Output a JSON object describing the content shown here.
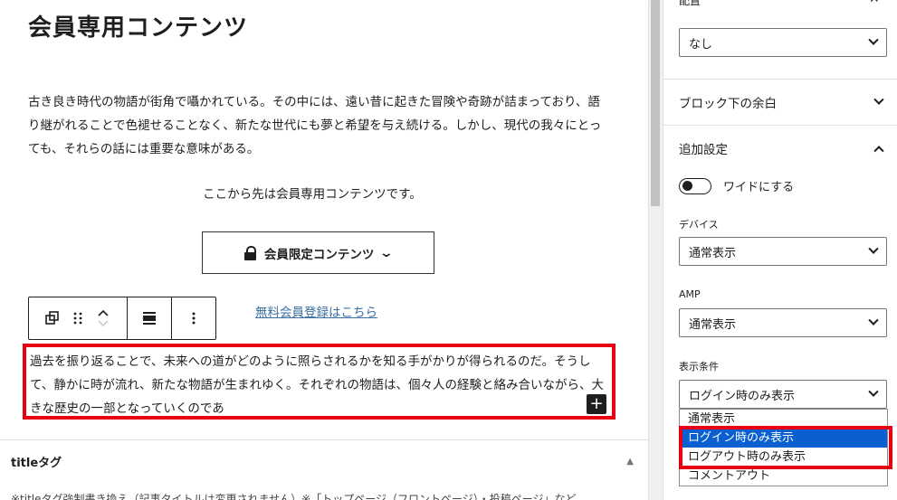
{
  "editor": {
    "title": "会員専用コンテンツ",
    "paragraph": "古き良き時代の物語が街角で囁かれている。その中には、遠い昔に起きた冒険や奇跡が詰まっており、語り継がれることで色褪せることなく、新たな世代にも夢と希望を与え続ける。しかし、現代の我々にとっても、それらの話には重要な意味がある。",
    "center_text": "ここから先は会員専用コンテンツです。",
    "member_button_label": "会員限定コンテンツ",
    "register_link": "無料会員登録はこちら",
    "selected_paragraph": "過去を振り返ることで、未来への道がどのように照らされるかを知る手がかりが得られるのだ。そうして、静かに時が流れ、新たな物語が生まれゆく。それぞれの物語は、個々人の経験と絡み合いながら、大きな歴史の一部となっていくのであ",
    "title_tag_label": "titleタグ",
    "cut_line": "※titleタグ強制書き換え（記事タイトルは変更されません）※「トップページ（フロントページ）・投稿ページ」など"
  },
  "sidebar": {
    "top_label": "配置",
    "top_select": "なし",
    "block_margin_label": "ブロック下の余白",
    "extra_settings_label": "追加設定",
    "wide_toggle_label": "ワイドにする",
    "device_label": "デバイス",
    "device_value": "通常表示",
    "amp_label": "AMP",
    "amp_value": "通常表示",
    "condition_label": "表示条件",
    "condition_value": "ログイン時のみ表示",
    "dropdown_options": [
      "通常表示",
      "ログイン時のみ表示",
      "ログアウト時のみ表示",
      "コメントアウト"
    ]
  },
  "colors": {
    "highlight_red": "#e60012",
    "select_blue": "#0a5fd1",
    "link_blue": "#3a6ea5"
  }
}
